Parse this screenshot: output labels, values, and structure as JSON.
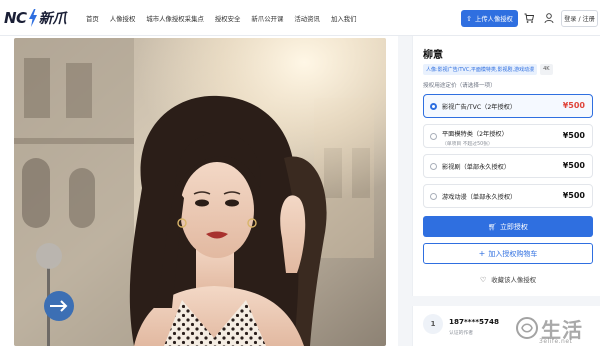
{
  "header": {
    "logo_text": "NC",
    "logo_cn": "新爪",
    "nav": [
      "首页",
      "人像授权",
      "城市人像授权采集点",
      "授权安全",
      "新爪公开课",
      "活动资讯",
      "加入我们"
    ],
    "upload_label": "上传人像授权",
    "login_label": "登录 / 注册"
  },
  "colors": {
    "accent": "#2f6fe0",
    "price_selected": "#e0463c"
  },
  "panel": {
    "title": "柳意",
    "tags": [
      "人像:影视广告/TVC,平面模特类,影视剧,游戏动漫",
      "4K"
    ],
    "section_label": "授权用途定价（请选择一项）",
    "options": [
      {
        "label": "影视广告/TVC（2年授权）",
        "sub": "",
        "price": "¥500",
        "selected": true
      },
      {
        "label": "平面模特类（2年授权）",
        "sub": "（单项目 不超过50张）",
        "price": "¥500",
        "selected": false
      },
      {
        "label": "影视剧（单部永久授权）",
        "sub": "",
        "price": "¥500",
        "selected": false
      },
      {
        "label": "游戏动漫（单部永久授权）",
        "sub": "",
        "price": "¥500",
        "selected": false
      }
    ],
    "buy_label": "立即授权",
    "cart_label": "加入授权购物车",
    "fav_label": "收藏该人像授权"
  },
  "author": {
    "avatar_text": "1",
    "name": "187****5748",
    "subtitle": "认证的作者"
  },
  "watermark": {
    "cn": "生活",
    "url": "3elife.net"
  }
}
